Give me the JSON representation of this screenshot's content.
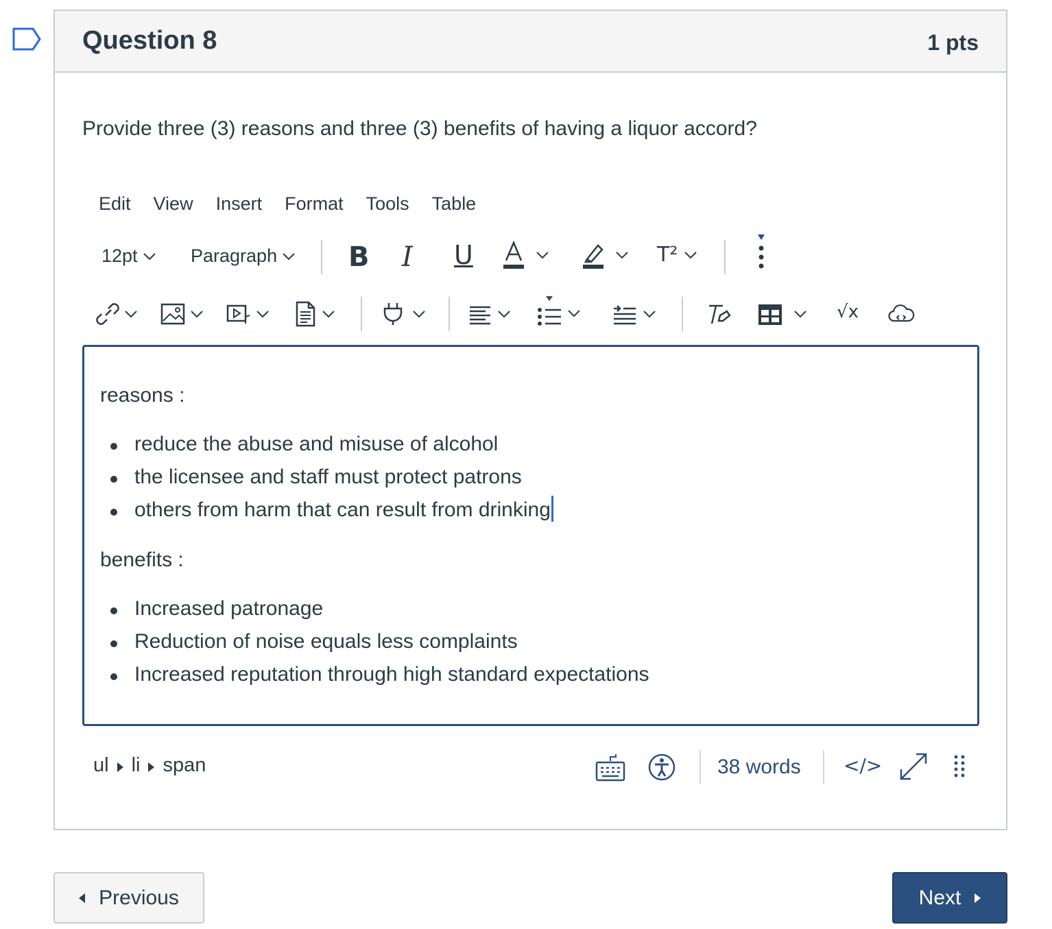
{
  "question": {
    "title": "Question 8",
    "points": "1 pts",
    "text": "Provide three (3) reasons and three (3) benefits of having a liquor accord?"
  },
  "menubar": [
    "Edit",
    "View",
    "Insert",
    "Format",
    "Tools",
    "Table"
  ],
  "toolbar": {
    "font_size": "12pt",
    "block_format": "Paragraph",
    "bold_label": "B",
    "italic_label": "I",
    "underline_label": "U",
    "text_color_label": "A",
    "superscript_label": "T²",
    "math_label": "√x"
  },
  "editor": {
    "reasons_heading": "reasons :",
    "reasons": [
      "reduce the abuse and misuse of alcohol",
      "the licensee and staff must protect patrons",
      "others from harm that can result from drinking"
    ],
    "benefits_heading": "benefits :",
    "benefits": [
      "Increased patronage",
      "Reduction of noise equals less complaints",
      "Increased reputation through high standard expectations"
    ]
  },
  "statusbar": {
    "path": [
      "ul",
      "li",
      "span"
    ],
    "word_count": "38 words",
    "html_toggle": "</>"
  },
  "nav": {
    "previous_label": "Previous",
    "next_label": "Next"
  },
  "colors": {
    "primary": "#2b4f7e",
    "text": "#2d3b45",
    "border": "#c7cdd1",
    "header_bg": "#f5f5f5",
    "caret": "#2b6cd8"
  }
}
